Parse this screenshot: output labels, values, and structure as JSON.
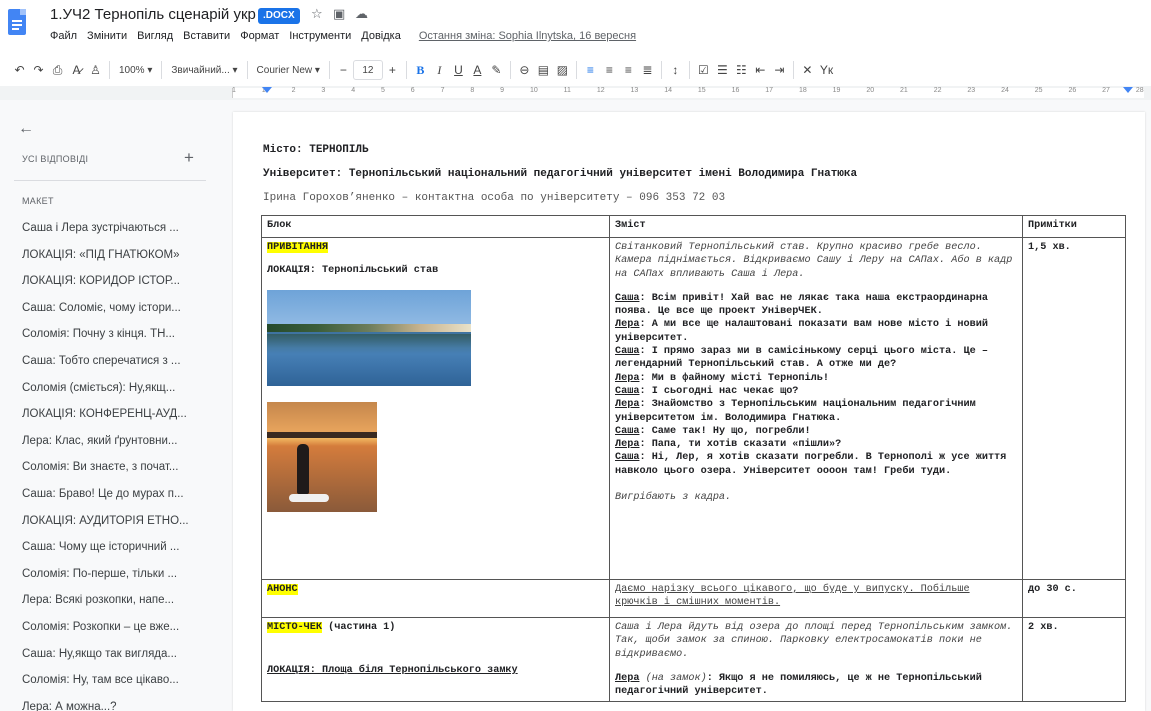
{
  "doc": {
    "title": "1.УЧ2 Тернопіль сценарій укр",
    "badge": ".DOCX",
    "icons": [
      "star-icon",
      "folder-icon",
      "cloud-icon"
    ]
  },
  "menu": {
    "items": [
      "Файл",
      "Змінити",
      "Вигляд",
      "Вставити",
      "Формат",
      "Інструменти",
      "Довідка"
    ],
    "last_edit": "Остання зміна: Sophia Ilnytska, 16 вересня"
  },
  "toolbar": {
    "zoom": "100%",
    "style": "Звичайний...",
    "font": "Courier New",
    "size": "12",
    "minus": "−",
    "plus": "+",
    "bold": "B",
    "italic": "I",
    "underline": "U",
    "textcolor": "A",
    "clear": "Yк"
  },
  "ruler": {
    "numbers": [
      "1",
      "1",
      "2",
      "3",
      "4",
      "5",
      "6",
      "7",
      "8",
      "9",
      "10",
      "11",
      "12",
      "13",
      "14",
      "15",
      "16",
      "17",
      "18",
      "19",
      "20",
      "21",
      "22",
      "23",
      "24",
      "25",
      "26",
      "27",
      "28"
    ]
  },
  "sidebar": {
    "all_answers": "УСІ ВІДПОВІДІ",
    "section": "МАКЕТ",
    "items": [
      "Саша і Лера зустрічаються ...",
      "ЛОКАЦІЯ: «ПІД ГНАТЮКОМ»",
      "ЛОКАЦІЯ: КОРИДОР ІСТОР...",
      "Саша: Соломіє, чому істори...",
      "Соломія: Почну з кінця. ТН...",
      "Саша: Тобто сперечатися з ...",
      "Соломія (сміється): Ну,якщ...",
      "ЛОКАЦІЯ: КОНФЕРЕНЦ-АУД...",
      "Лера: Клас, який ґрунтовни...",
      "Соломія: Ви знаєте, з почат...",
      "Саша: Браво! Це до мурах п...",
      "ЛОКАЦІЯ: АУДИТОРІЯ ЕТНО...",
      "Саша: Чому ще історичний ...",
      "Соломія: По-перше, тільки ...",
      "Лера: Всякі розкопки, напе...",
      "Соломія: Розкопки – це вже...",
      "Саша: Ну,якщо так виглядa...",
      "Соломія: Ну, там все цікаво...",
      "Лера: А можна...?"
    ]
  },
  "page": {
    "city_label": "Місто: ",
    "city": "ТЕРНОПІЛЬ",
    "uni_label": "Університет: ",
    "uni": "Тернопільський національний педагогічний університет імені Володимира Гнатюка",
    "contact": "Ірина Горохов’яненко – контактна особа по університету – 096 353 72 03"
  },
  "table": {
    "headers": [
      "Блок",
      "Зміст",
      "Примітки"
    ],
    "row1": {
      "block_title": "ПРИВІТАННЯ",
      "location": "ЛОКАЦІЯ: Тернопільський став",
      "intro": "Світанковий Тернопільський став. Крупно красиво гребе весло. Камера піднімається. Відкриваємо Сашу і Леру на САПах. Або в кадр на САПах впливають Саша і Лера.",
      "lines": [
        {
          "who": "Саша",
          "text": ": Всім привіт! Хай вас не лякає така наша екстраординарна поява.  Це все ще проект УніверЧЕК."
        },
        {
          "who": "Лера",
          "text": ": А ми все ще налаштовані показати вам нове місто і новий університет."
        },
        {
          "who": "Саша",
          "text": ": І прямо зараз ми в самісінькому серці цього міста. Це – легендарний Тернопільський став. А отже ми де?"
        },
        {
          "who": "Лера",
          "text": ": Ми в файному місті Тернопіль!"
        },
        {
          "who": "Саша",
          "text": ": І сьогодні нас чекає що?"
        },
        {
          "who": "Лера",
          "text": ": Знайомство з Тернопільським національним педагогічним університетом ім. Володимира Гнатюка."
        },
        {
          "who": "Саша",
          "text": ": Саме так! Ну що, погребли!"
        },
        {
          "who": "Лера",
          "text": ": Папа, ти хотів сказати «пішли»?"
        },
        {
          "who": "Саша",
          "text": ": Ні, Лер, я хотів сказати погребли. В Тернополі ж усе життя навколо цього озера. Університет оооон там! Греби туди."
        }
      ],
      "outro": "Вигрібають з кадра.",
      "note": "1,5 хв."
    },
    "row2": {
      "block_title": "АНОНС",
      "content": "Даємо нарізку всього цікавого, що буде у випуску. Побільше крючків і смішних моментів.",
      "note": "до 30 с."
    },
    "row3": {
      "block_title": "МІСТО-ЧЕК",
      "block_suffix": " (частина 1)",
      "location": "ЛОКАЦІЯ: Площа біля Тернопільського замку",
      "intro": "Саша і Лера йдуть від озера до площі перед Тернопільським замком. Так, щоби замок за спиною. Парковку електросамокатів поки не відкриваємо.",
      "who": "Лера",
      "aside": " (на замок)",
      "line": ": Якщо я не помиляюсь, це ж не Тернопільський педагогічний університет.",
      "note": "2 хв."
    }
  }
}
